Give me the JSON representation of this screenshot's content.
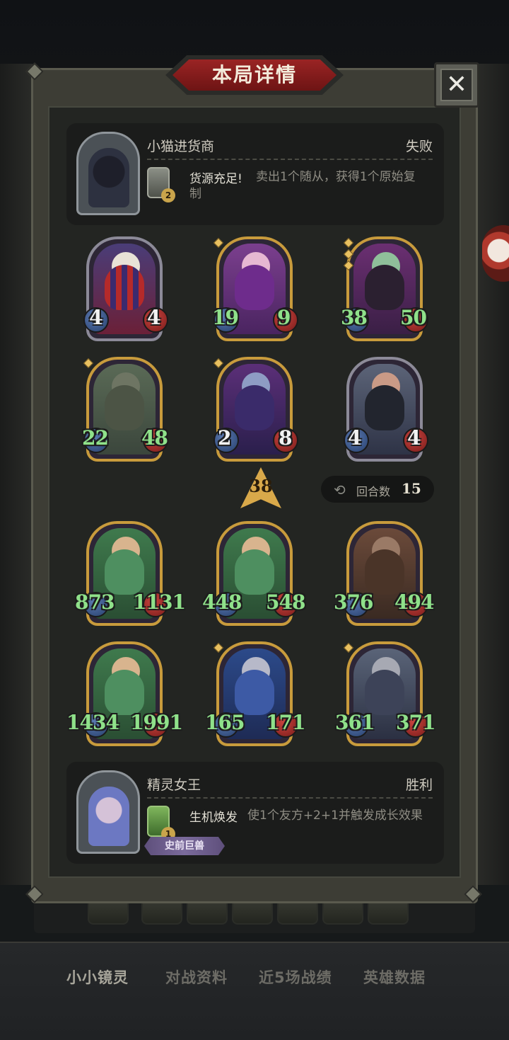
{
  "window": {
    "title": "本局详情",
    "close_label": "✕"
  },
  "opponent": {
    "name": "小猫进货商",
    "result": "失败",
    "spell": {
      "name": "货源充足!",
      "desc_line1": "卖出1个随从，获得1个原始复",
      "desc_line2": "制",
      "badge": "2"
    }
  },
  "opponent_board": [
    {
      "atk": "4",
      "hp": "4"
    },
    {
      "atk": "19",
      "hp": "9"
    },
    {
      "atk": "38",
      "hp": "50"
    },
    {
      "atk": "22",
      "hp": "48"
    },
    {
      "atk": "2",
      "hp": "8"
    },
    {
      "atk": "4",
      "hp": "4"
    }
  ],
  "rank": "38",
  "rounds": {
    "label": "回合数",
    "value": "15"
  },
  "player_board": [
    {
      "atk": "873",
      "hp": "1131"
    },
    {
      "atk": "448",
      "hp": "548"
    },
    {
      "atk": "376",
      "hp": "494"
    },
    {
      "atk": "1434",
      "hp": "1991"
    },
    {
      "atk": "165",
      "hp": "171"
    },
    {
      "atk": "361",
      "hp": "371"
    }
  ],
  "player": {
    "name": "精灵女王",
    "result": "胜利",
    "spell": {
      "name": "生机焕发",
      "desc": "使1个友方+2+1并触发成长效果",
      "badge": "1"
    },
    "tag": "史前巨兽"
  },
  "bottom_tabs": [
    "小小镜灵",
    "对战资料",
    "近5场战绩",
    "英雄数据"
  ],
  "colors": {
    "gold_frame": "#c89b3c",
    "buff_stat": "#8fe18a",
    "title_red": "#9a2424"
  }
}
